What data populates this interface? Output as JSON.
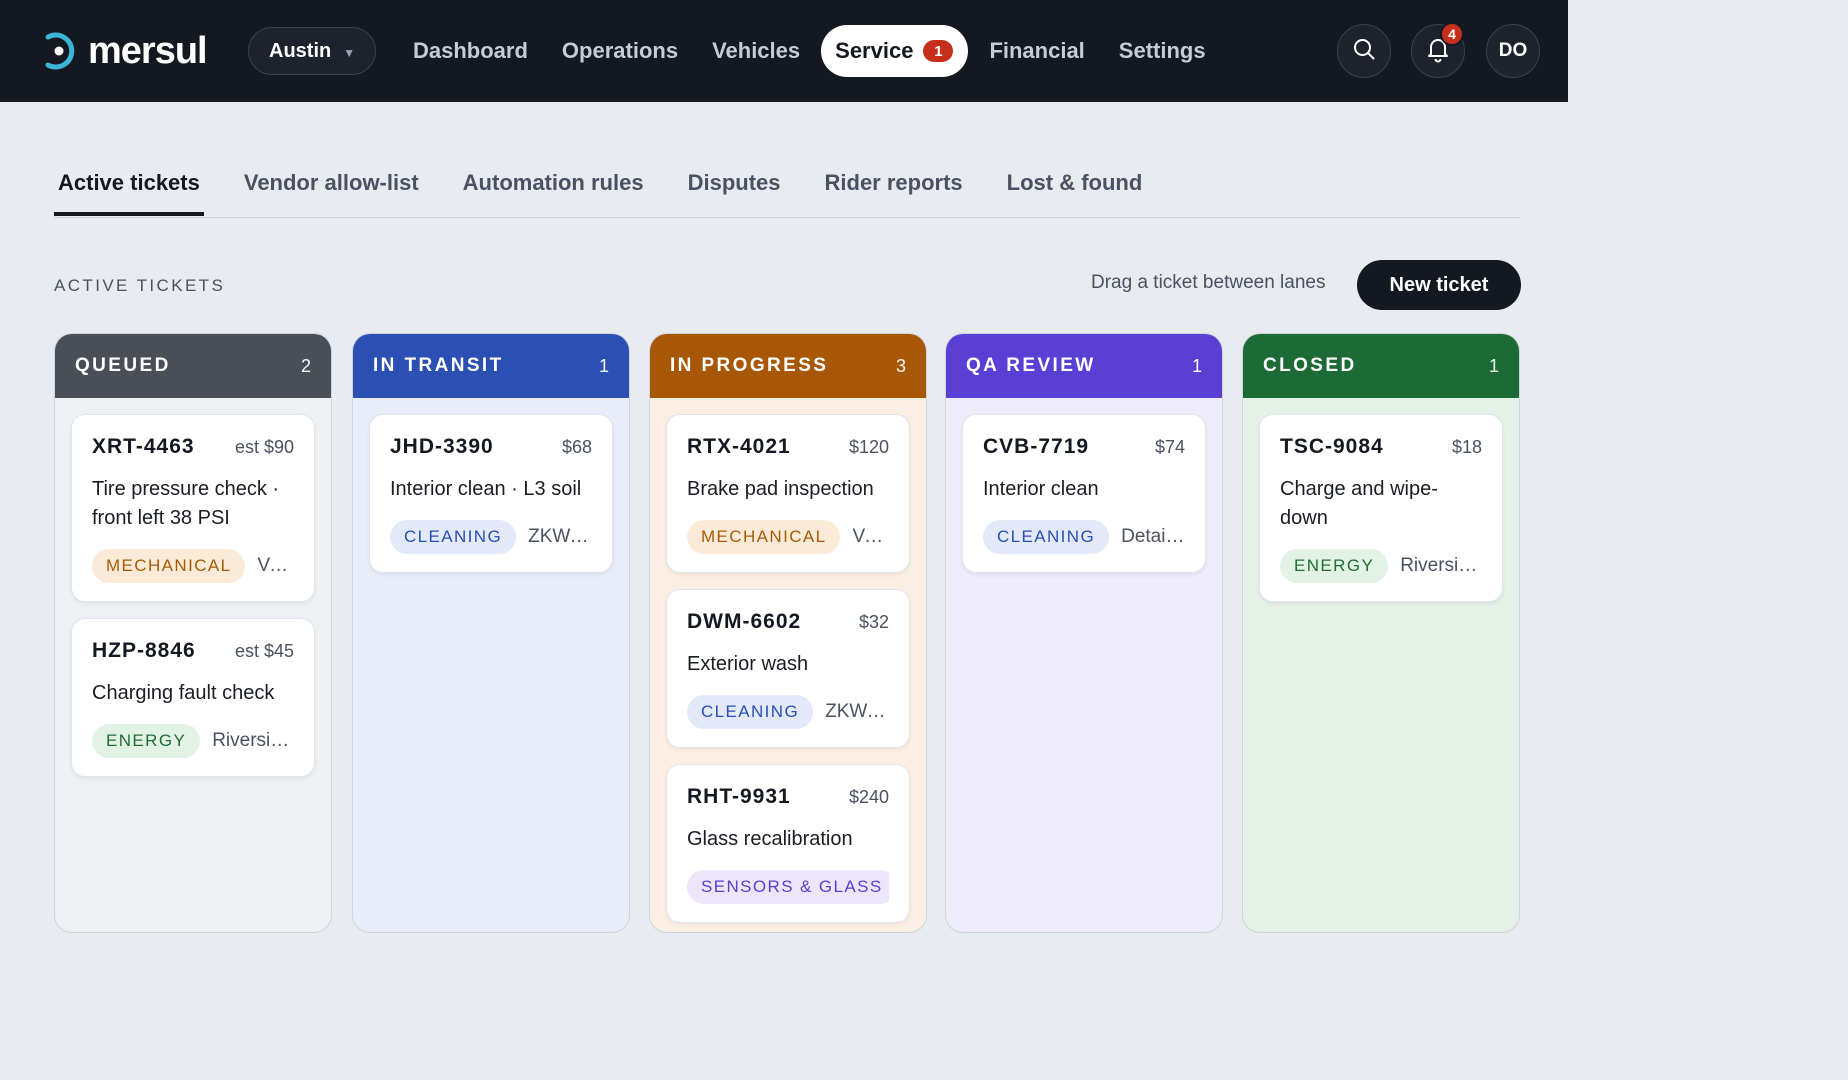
{
  "brand": {
    "name": "mersul"
  },
  "city": {
    "label": "Austin"
  },
  "nav": {
    "items": [
      {
        "label": "Dashboard"
      },
      {
        "label": "Operations"
      },
      {
        "label": "Vehicles"
      },
      {
        "label": "Service",
        "badge": "1"
      },
      {
        "label": "Financial"
      },
      {
        "label": "Settings"
      }
    ]
  },
  "header_actions": {
    "search_icon": "search-icon",
    "notifications_count": "4",
    "avatar_initials": "DO"
  },
  "tabs": [
    {
      "label": "Active tickets"
    },
    {
      "label": "Vendor allow-list"
    },
    {
      "label": "Automation rules"
    },
    {
      "label": "Disputes"
    },
    {
      "label": "Rider reports"
    },
    {
      "label": "Lost & found"
    }
  ],
  "section": {
    "label": "ACTIVE TICKETS",
    "hint": "Drag a ticket between lanes",
    "new_button": "New ticket"
  },
  "colors": {
    "queued": "#4a4e57",
    "in_transit": "#2c4fb4",
    "in_progress": "#a85706",
    "qa_review": "#5a3fd4",
    "closed": "#1c6b37"
  },
  "lanes": [
    {
      "title": "QUEUED",
      "count": "2",
      "cards": [
        {
          "id": "XRT-4463",
          "price": "est $90",
          "title": "Tire pressure check · front left 38 PSI",
          "tag": "MECHANICAL",
          "vendor": "Vo..."
        },
        {
          "id": "HZP-8846",
          "price": "est $45",
          "title": "Charging fault check",
          "tag": "ENERGY",
          "vendor": "Riversid..."
        }
      ]
    },
    {
      "title": "IN TRANSIT",
      "count": "1",
      "cards": [
        {
          "id": "JHD-3390",
          "price": "$68",
          "title": "Interior clean · L3 soil",
          "tag": "CLEANING",
          "vendor": "ZKWa..."
        }
      ]
    },
    {
      "title": "IN PROGRESS",
      "count": "3",
      "cards": [
        {
          "id": "RTX-4021",
          "price": "$120",
          "title": "Brake pad inspection",
          "tag": "MECHANICAL",
          "vendor": "Vo..."
        },
        {
          "id": "DWM-6602",
          "price": "$32",
          "title": "Exterior wash",
          "tag": "CLEANING",
          "vendor": "ZKWa..."
        },
        {
          "id": "RHT-9931",
          "price": "$240",
          "title": "Glass recalibration",
          "tag": "SENSORS & GLASS",
          "vendor": ""
        }
      ]
    },
    {
      "title": "QA REVIEW",
      "count": "1",
      "cards": [
        {
          "id": "CVB-7719",
          "price": "$74",
          "title": "Interior clean",
          "tag": "CLEANING",
          "vendor": "Detail..."
        }
      ]
    },
    {
      "title": "CLOSED",
      "count": "1",
      "cards": [
        {
          "id": "TSC-9084",
          "price": "$18",
          "title": "Charge and wipe-down",
          "tag": "ENERGY",
          "vendor": "Riversid..."
        }
      ]
    }
  ]
}
